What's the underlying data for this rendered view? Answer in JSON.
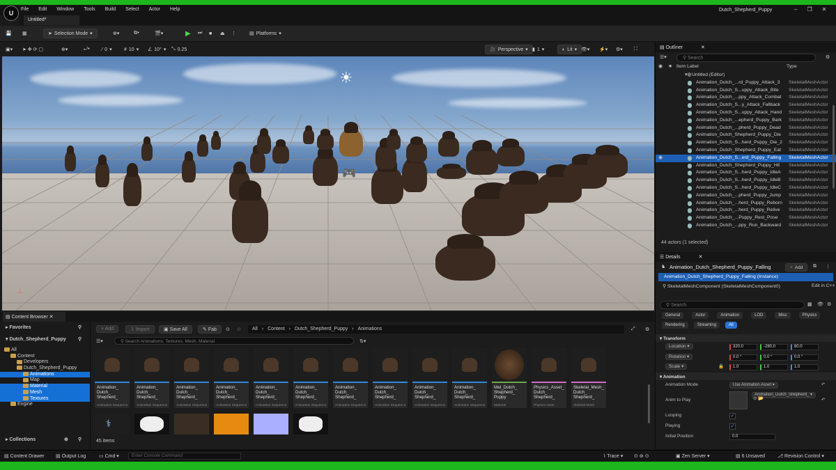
{
  "app": {
    "menu": [
      "File",
      "Edit",
      "Window",
      "Tools",
      "Build",
      "Select",
      "Actor",
      "Help"
    ],
    "window_title": "Dutch_Shepherd_Puppy",
    "level_tab": "Untitled*"
  },
  "toolbar": {
    "selection_mode": "Selection Mode",
    "platforms": "Platforms"
  },
  "viewport_bar": {
    "snap_rotate": "0",
    "snap_grid": "10",
    "snap_angle": "10°",
    "snap_scale": "0.25",
    "perspective": "Perspective",
    "view_count": "1",
    "lit": "Lit"
  },
  "outliner": {
    "title": "Outliner",
    "search_placeholder": "Search",
    "col_label": "Item Label",
    "col_type": "Type",
    "root": "Untitled (Editor)",
    "items": [
      {
        "name": "Animation_Dutch_...rd_Puppy_Attack_3",
        "type": "SkeletalMeshActor"
      },
      {
        "name": "Animation_Dutch_S...uppy_Attack_Bite",
        "type": "SkeletalMeshActor"
      },
      {
        "name": "Animation_Dutch_...ppy_Attack_Combat",
        "type": "SkeletalMeshActor"
      },
      {
        "name": "Animation_Dutch_S...y_Attack_Fallback",
        "type": "SkeletalMeshActor"
      },
      {
        "name": "Animation_Dutch_S...uppy_Attack_Hand",
        "type": "SkeletalMeshActor"
      },
      {
        "name": "Animation_Dutch_...epherd_Puppy_Bark",
        "type": "SkeletalMeshActor"
      },
      {
        "name": "Animation_Dutch_...pherd_Puppy_Dead",
        "type": "SkeletalMeshActor"
      },
      {
        "name": "Animation_Dutch_Shepherd_Puppy_Die",
        "type": "SkeletalMeshActor"
      },
      {
        "name": "Animation_Dutch_S...herd_Puppy_Die_2",
        "type": "SkeletalMeshActor"
      },
      {
        "name": "Animation_Dutch_Shepherd_Puppy_Eat",
        "type": "SkeletalMeshActor"
      },
      {
        "name": "Animation_Dutch_S...erd_Puppy_Falling",
        "type": "SkeletalMeshActor",
        "selected": true
      },
      {
        "name": "Animation_Dutch_Shepherd_Puppy_Hit",
        "type": "SkeletalMeshActor"
      },
      {
        "name": "Animation_Dutch_S...herd_Puppy_IdleA",
        "type": "SkeletalMeshActor"
      },
      {
        "name": "Animation_Dutch_S...herd_Puppy_IdleB",
        "type": "SkeletalMeshActor"
      },
      {
        "name": "Animation_Dutch_S...herd_Puppy_IdleC",
        "type": "SkeletalMeshActor"
      },
      {
        "name": "Animation_Dutch_...pherd_Puppy_Jump",
        "type": "SkeletalMeshActor"
      },
      {
        "name": "Animation_Dutch_...herd_Puppy_Reborn",
        "type": "SkeletalMeshActor"
      },
      {
        "name": "Animation_Dutch_...herd_Puppy_Relive",
        "type": "SkeletalMeshActor"
      },
      {
        "name": "Animation_Dutch_...Puppy_Rest_Pose",
        "type": "SkeletalMeshActor"
      },
      {
        "name": "Animation_Dutch_...ppy_Run_Backward",
        "type": "SkeletalMeshActor"
      }
    ],
    "footer": "44 actors (1 selected)"
  },
  "details": {
    "title": "Details",
    "actor_name": "Animation_Dutch_Shepherd_Puppy_Falling",
    "add_label": "Add",
    "instance": "Animation_Dutch_Shepherd_Puppy_Falling (Instance)",
    "component": "SkeletalMeshComponent (SkeletalMeshComponent0)",
    "edit_cpp": "Edit in C++",
    "search_placeholder": "Search",
    "filters_row1": [
      "General",
      "Actor",
      "Animation",
      "LOD",
      "Misc",
      "Physics"
    ],
    "filters_row2": [
      "Rendering",
      "Streaming",
      "All"
    ],
    "active_filter": "All",
    "transform_section": "Transform",
    "location_label": "Location",
    "rotation_label": "Rotation",
    "scale_label": "Scale",
    "location": [
      "320.0",
      "-280.0",
      "80.0"
    ],
    "rotation": [
      "0.0 °",
      "0.0 °",
      "0.0 °"
    ],
    "scale": [
      "1.0",
      "1.0",
      "1.0"
    ],
    "animation_section": "Animation",
    "anim_mode_label": "Animation Mode",
    "anim_mode_value": "Use Animation Asset",
    "anim_to_play_label": "Anim to Play",
    "anim_to_play_value": "Animation_Dutch_Shepherd_",
    "looping_label": "Looping",
    "playing_label": "Playing",
    "initial_position_label": "Initial Position",
    "initial_position_value": "0.0"
  },
  "content_browser": {
    "tab": "Content Browser",
    "add_label": "Add",
    "import_label": "Import",
    "save_all_label": "Save All",
    "fab_label": "Fab",
    "breadcrumb": [
      "All",
      "Content",
      "Dutch_Shepherd_Puppy",
      "Animations"
    ],
    "search_placeholder": "Search Animations, Textures, Mesh, Material",
    "favorites": "Favorites",
    "project": "Dutch_Shepherd_Puppy",
    "tree": [
      {
        "label": "All",
        "level": 0
      },
      {
        "label": "Content",
        "level": 1
      },
      {
        "label": "Developers",
        "level": 2
      },
      {
        "label": "Dutch_Shepherd_Puppy",
        "level": 2
      },
      {
        "label": "Animations",
        "level": 3,
        "selected": true
      },
      {
        "label": "Map",
        "level": 3
      },
      {
        "label": "Material",
        "level": 3,
        "selected": true
      },
      {
        "label": "Mesh",
        "level": 3,
        "selected": true
      },
      {
        "label": "Textures",
        "level": 3,
        "selected": true
      },
      {
        "label": "Engine",
        "level": 1
      }
    ],
    "collections": "Collections",
    "item_count": "45 items",
    "assets": [
      {
        "l1": "Animation_",
        "l2": "Dutch_",
        "l3": "Shepherd_",
        "type": "Animation Sequence"
      },
      {
        "l1": "Animation_",
        "l2": "Dutch_",
        "l3": "Shepherd_",
        "type": "Animation Sequence"
      },
      {
        "l1": "Animation_",
        "l2": "Dutch_",
        "l3": "Shepherd_",
        "type": "Animation Sequence"
      },
      {
        "l1": "Animation_",
        "l2": "Dutch_",
        "l3": "Shepherd_",
        "type": "Animation Sequence"
      },
      {
        "l1": "Animation_",
        "l2": "Dutch_",
        "l3": "Shepherd_",
        "type": "Animation Sequence"
      },
      {
        "l1": "Animation_",
        "l2": "Dutch_",
        "l3": "Shepherd_",
        "type": "Animation Sequence"
      },
      {
        "l1": "Animation_",
        "l2": "Dutch_",
        "l3": "Shepherd_",
        "type": "Animation Sequence"
      },
      {
        "l1": "Animation_",
        "l2": "Dutch_",
        "l3": "Shepherd_",
        "type": "Animation Sequence"
      },
      {
        "l1": "Animation_",
        "l2": "Dutch_",
        "l3": "Shepherd_",
        "type": "Animation Sequence"
      },
      {
        "l1": "Animation_",
        "l2": "Dutch_",
        "l3": "Shepherd_",
        "type": "Animation Sequence"
      },
      {
        "l1": "Mat_Dutch_",
        "l2": "Shepherd_",
        "l3": "Puppy",
        "type": "Material"
      },
      {
        "l1": "Physics_Asset_",
        "l2": "Dutch_",
        "l3": "Shepherd_",
        "type": "Physics Asset"
      },
      {
        "l1": "Skeletal_Mesh_",
        "l2": "Dutch_",
        "l3": "Shepherd_",
        "type": "Skeletal Mesh"
      }
    ]
  },
  "statusbar": {
    "content_drawer": "Content Drawer",
    "output_log": "Output Log",
    "cmd": "Cmd",
    "console_placeholder": "Enter Console Command",
    "trace": "Trace",
    "zen": "Zen Server",
    "unsaved": "6 Unsaved",
    "revision": "Revision Control"
  },
  "colors": {
    "accent": "#1570d6",
    "play": "#4fd04f",
    "frame": "#1db71d"
  }
}
